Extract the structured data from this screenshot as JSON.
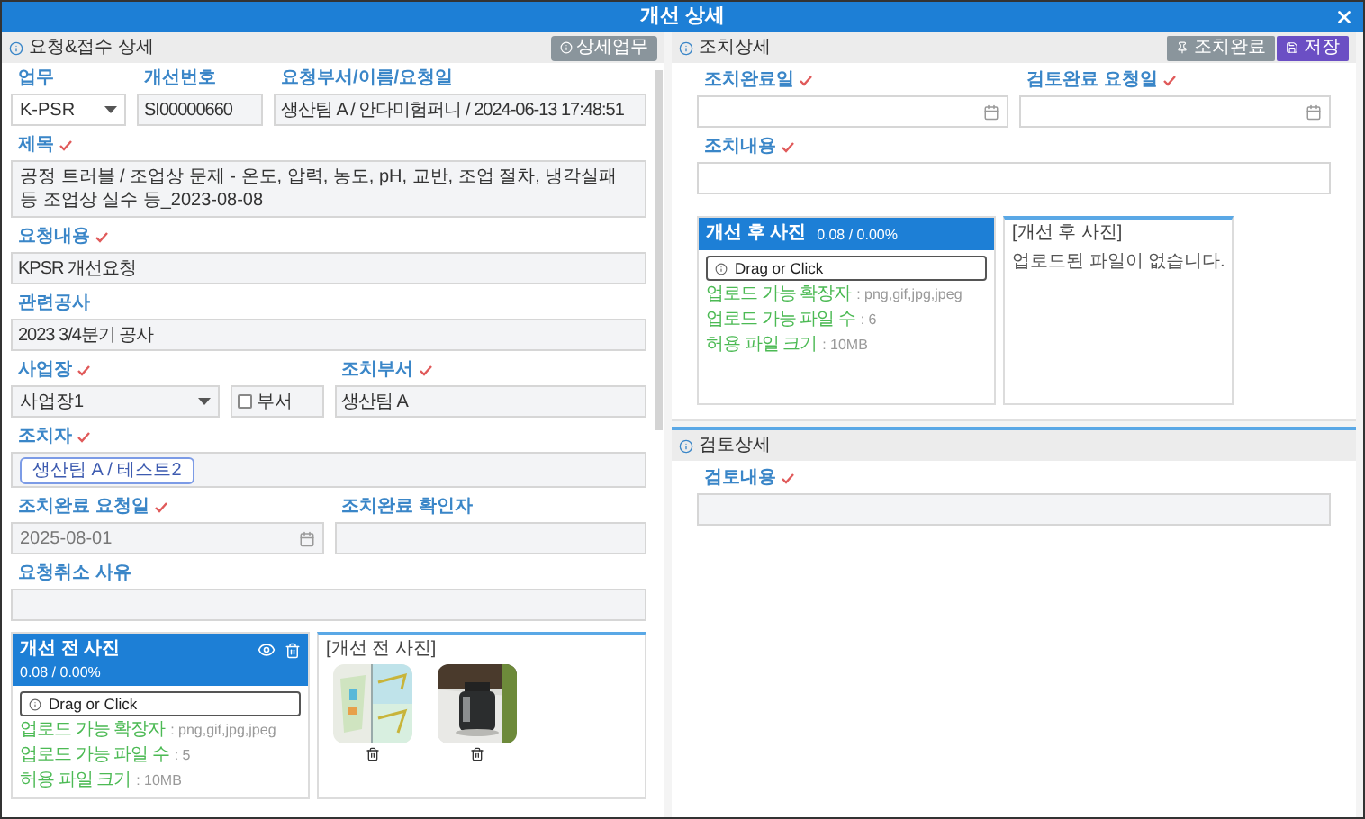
{
  "window": {
    "title": "개선 상세"
  },
  "request_panel": {
    "title": "요청&접수 상세",
    "button": "상세업무",
    "rows": [
      {
        "fields": [
          {
            "kind": "select",
            "label": "업무",
            "required": false,
            "readonly": false,
            "value": "K-PSR"
          },
          {
            "kind": "text",
            "label": "개선번호",
            "required": false,
            "readonly": true,
            "value": "SI00000660"
          },
          {
            "kind": "text",
            "label": "요청부서/이름/요청일",
            "required": false,
            "readonly": true,
            "value": "생산팀 A / 안다미험퍼니 / 2024-06-13 17:48:51"
          }
        ]
      },
      {
        "fields": [
          {
            "kind": "textarea",
            "label": "제목",
            "required": true,
            "readonly": true,
            "value": "공정 트러블 / 조업상 문제 - 온도, 압력, 농도, pH, 교반, 조업 절차, 냉각실패 등 조업상 실수 등_2023-08-08"
          }
        ]
      },
      {
        "fields": [
          {
            "kind": "text",
            "label": "요청내용",
            "required": true,
            "readonly": true,
            "value": "KPSR 개선요청"
          }
        ]
      },
      {
        "fields": [
          {
            "kind": "text",
            "label": "관련공사",
            "required": false,
            "readonly": true,
            "value": "2023 3/4분기 공사"
          }
        ]
      },
      {
        "fields": [
          {
            "kind": "select_check",
            "label": "사업장",
            "required": true,
            "readonly": true,
            "value": "사업장1",
            "checkbox": {
              "label": "부서",
              "checked": false
            }
          },
          {
            "kind": "text",
            "label": "조치부서",
            "required": true,
            "readonly": true,
            "value": "생산팀 A"
          }
        ]
      },
      {
        "fields": [
          {
            "kind": "tags",
            "label": "조치자",
            "required": true,
            "readonly": true,
            "tags": [
              "생산팀 A / 테스트2"
            ]
          }
        ]
      },
      {
        "fields": [
          {
            "kind": "date",
            "label": "조치완료 요청일",
            "required": true,
            "readonly": true,
            "value": "2025-08-01"
          },
          {
            "kind": "text",
            "label": "조치완료 확인자",
            "required": false,
            "readonly": true
          }
        ]
      },
      {
        "fields": [
          {
            "kind": "text",
            "label": "요청취소 사유",
            "required": false,
            "readonly": true
          }
        ]
      }
    ],
    "photos": {
      "title": "개선 전 사진",
      "usage": "0.08 / 0.00%",
      "actions": true,
      "upload": "Drag or Click",
      "info": [
        {
          "label": "업로드 가능 확장자",
          "value": ": png,gif,jpg,jpeg"
        },
        {
          "label": "업로드 가능 파일 수",
          "value": ": 5"
        },
        {
          "label": "허용 파일 크기",
          "value": ": 10MB"
        }
      ],
      "gallery_title": "[개선 전 사진]"
    }
  },
  "action_panel": {
    "title": "조치상세",
    "buttons": [
      {
        "label": "조치완료",
        "kind": "complete"
      },
      {
        "label": "저장",
        "kind": "save"
      }
    ],
    "rows": [
      {
        "fields": [
          {
            "kind": "date",
            "label": "조치완료일",
            "required": true,
            "readonly": false
          },
          {
            "kind": "date",
            "label": "검토완료 요청일",
            "required": true,
            "readonly": false
          }
        ]
      },
      {
        "fields": [
          {
            "kind": "text",
            "label": "조치내용",
            "required": true,
            "readonly": false
          }
        ]
      }
    ],
    "photos": {
      "title": "개선 후 사진",
      "usage": "0.08 / 0.00%",
      "actions": false,
      "upload": "Drag or Click",
      "info": [
        {
          "label": "업로드 가능 확장자",
          "value": ": png,gif,jpg,jpeg"
        },
        {
          "label": "업로드 가능 파일 수",
          "value": ": 6"
        },
        {
          "label": "허용 파일 크기",
          "value": ": 10MB"
        }
      ],
      "gallery_title": "[개선 후 사진]",
      "empty": "업로드된 파일이 없습니다."
    }
  },
  "review_panel": {
    "title": "검토상세",
    "rows": [
      {
        "fields": [
          {
            "kind": "text",
            "label": "검토내용",
            "required": true,
            "readonly": true
          }
        ]
      }
    ]
  }
}
